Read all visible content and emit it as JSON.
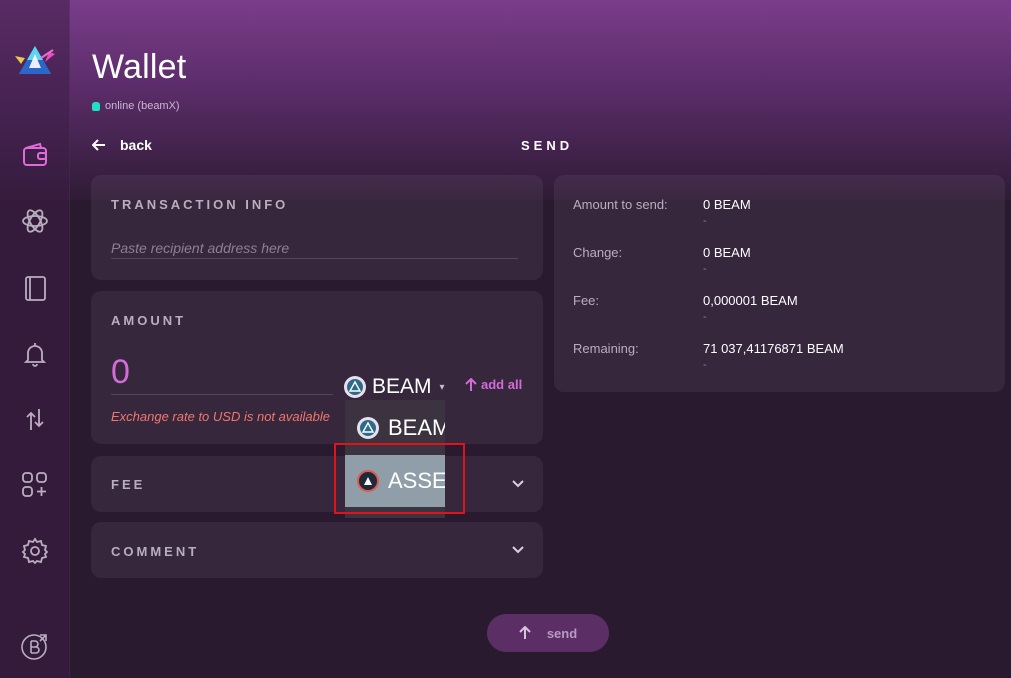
{
  "app": {
    "title": "Wallet",
    "status": "online (beamX)",
    "page_title": "SEND"
  },
  "nav": {
    "back_label": "back",
    "items": [
      {
        "icon": "wallet-icon"
      },
      {
        "icon": "atom-icon"
      },
      {
        "icon": "address-book-icon"
      },
      {
        "icon": "bell-icon"
      },
      {
        "icon": "transfer-arrows-icon"
      },
      {
        "icon": "apps-grid-icon"
      },
      {
        "icon": "settings-gear-icon"
      },
      {
        "icon": "beam-external-icon"
      }
    ]
  },
  "transaction_info": {
    "label": "TRANSACTION INFO",
    "address_placeholder": "Paste recipient address here",
    "address_value": ""
  },
  "amount": {
    "label": "AMOUNT",
    "placeholder": "0",
    "value": "",
    "rate_error": "Exchange rate to USD is not available",
    "selected_asset": "BEAM",
    "add_all_label": "add all",
    "dropdown_options": [
      "BEAM",
      "ASSE"
    ],
    "dropdown_selected_index": 1
  },
  "fee": {
    "label": "FEE"
  },
  "comment": {
    "label": "COMMENT"
  },
  "summary": {
    "rows": [
      {
        "key": "Amount to send:",
        "value": "0 BEAM",
        "sub": "-"
      },
      {
        "key": "Change:",
        "value": "0 BEAM",
        "sub": "-"
      },
      {
        "key": "Fee:",
        "value": "0,000001 BEAM",
        "sub": "-"
      },
      {
        "key": "Remaining:",
        "value": "71 037,41176871 BEAM",
        "sub": "-"
      }
    ]
  },
  "send_button": {
    "label": "send"
  },
  "colors": {
    "accent": "#d36bd8",
    "error": "#f0776e",
    "online": "#1fe0c5",
    "highlight": "#e0121b"
  }
}
